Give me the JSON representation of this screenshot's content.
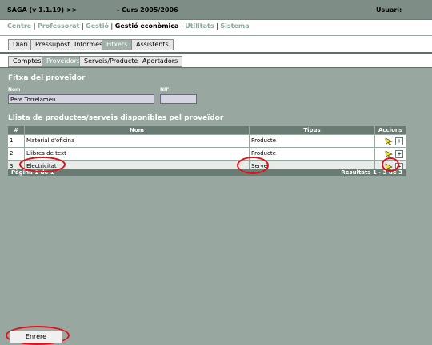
{
  "app": {
    "title": "SAGA (v 1.1.19) >>",
    "course": "- Curs 2005/2006",
    "user_label": "Usuari:"
  },
  "menu": {
    "items": [
      "Centre",
      "Professorat",
      "Gestió",
      "Gestió econòmica",
      "Utilitats",
      "Sistema"
    ],
    "selected": "Gestió econòmica",
    "separator": " | "
  },
  "tabs_main": [
    {
      "label": "Diari",
      "active": false
    },
    {
      "label": "Pressupost",
      "active": false
    },
    {
      "label": "Informes",
      "active": false
    },
    {
      "label": "Fitxers",
      "active": true
    },
    {
      "label": "Assistents",
      "active": false
    }
  ],
  "tabs_sub": [
    {
      "label": "Comptes",
      "active": false
    },
    {
      "label": "Proveïdors",
      "active": true
    },
    {
      "label": "Serveis/Productes",
      "active": false
    },
    {
      "label": "Aportadors",
      "active": false
    }
  ],
  "provider": {
    "section_title": "Fitxa del proveïdor",
    "name_label": "Nom",
    "name_value": "Pere Torrelameu",
    "nif_label": "NIF",
    "nif_value": ""
  },
  "list": {
    "section_title": "Llista de productes/serveis disponibles pel proveïdor",
    "columns": [
      "#",
      "Nom",
      "Tipus",
      "Accions"
    ],
    "rows": [
      {
        "num": "1",
        "name": "Material d'oficina",
        "type": "Producte"
      },
      {
        "num": "2",
        "name": "Llibres de text",
        "type": "Producte"
      },
      {
        "num": "3",
        "name": "Electricitat",
        "type": "Servei"
      }
    ],
    "page_info": "Pàgina 1 de 1",
    "results_info": "Resultats 1 - 3 de 3",
    "add_symbol": "+"
  },
  "buttons": {
    "back": "Enrere"
  },
  "colors": {
    "background": "#98a8a0",
    "header": "#6a7b73",
    "highlight_circle": "#e0101a"
  }
}
